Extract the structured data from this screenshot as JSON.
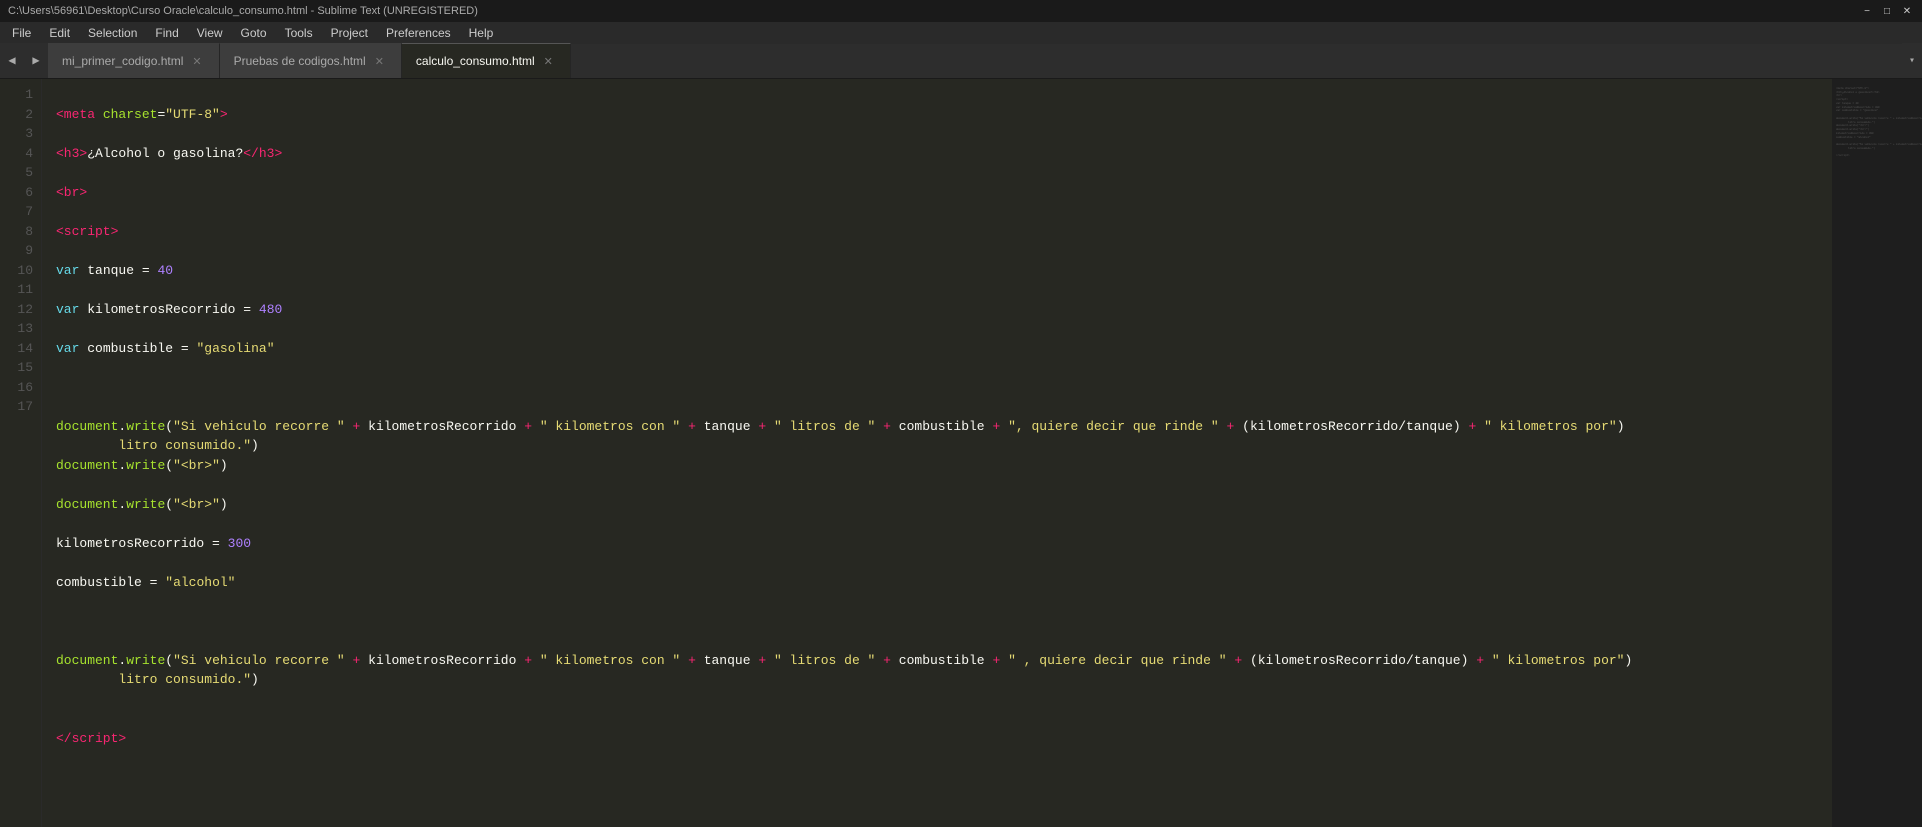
{
  "titleBar": {
    "title": "C:\\Users\\56961\\Desktop\\Curso Oracle\\calculo_consumo.html - Sublime Text (UNREGISTERED)",
    "minimize": "−",
    "maximize": "□",
    "close": "✕"
  },
  "menuBar": {
    "items": [
      "File",
      "Edit",
      "Selection",
      "Find",
      "View",
      "Goto",
      "Tools",
      "Project",
      "Preferences",
      "Help"
    ]
  },
  "tabs": [
    {
      "label": "mi_primer_codigo.html",
      "active": false
    },
    {
      "label": "Pruebas de codigos.html",
      "active": false
    },
    {
      "label": "calculo_consumo.html",
      "active": true
    }
  ],
  "lineNumbers": [
    1,
    2,
    3,
    4,
    5,
    6,
    7,
    8,
    9,
    10,
    11,
    12,
    13,
    14,
    15,
    16,
    17
  ]
}
